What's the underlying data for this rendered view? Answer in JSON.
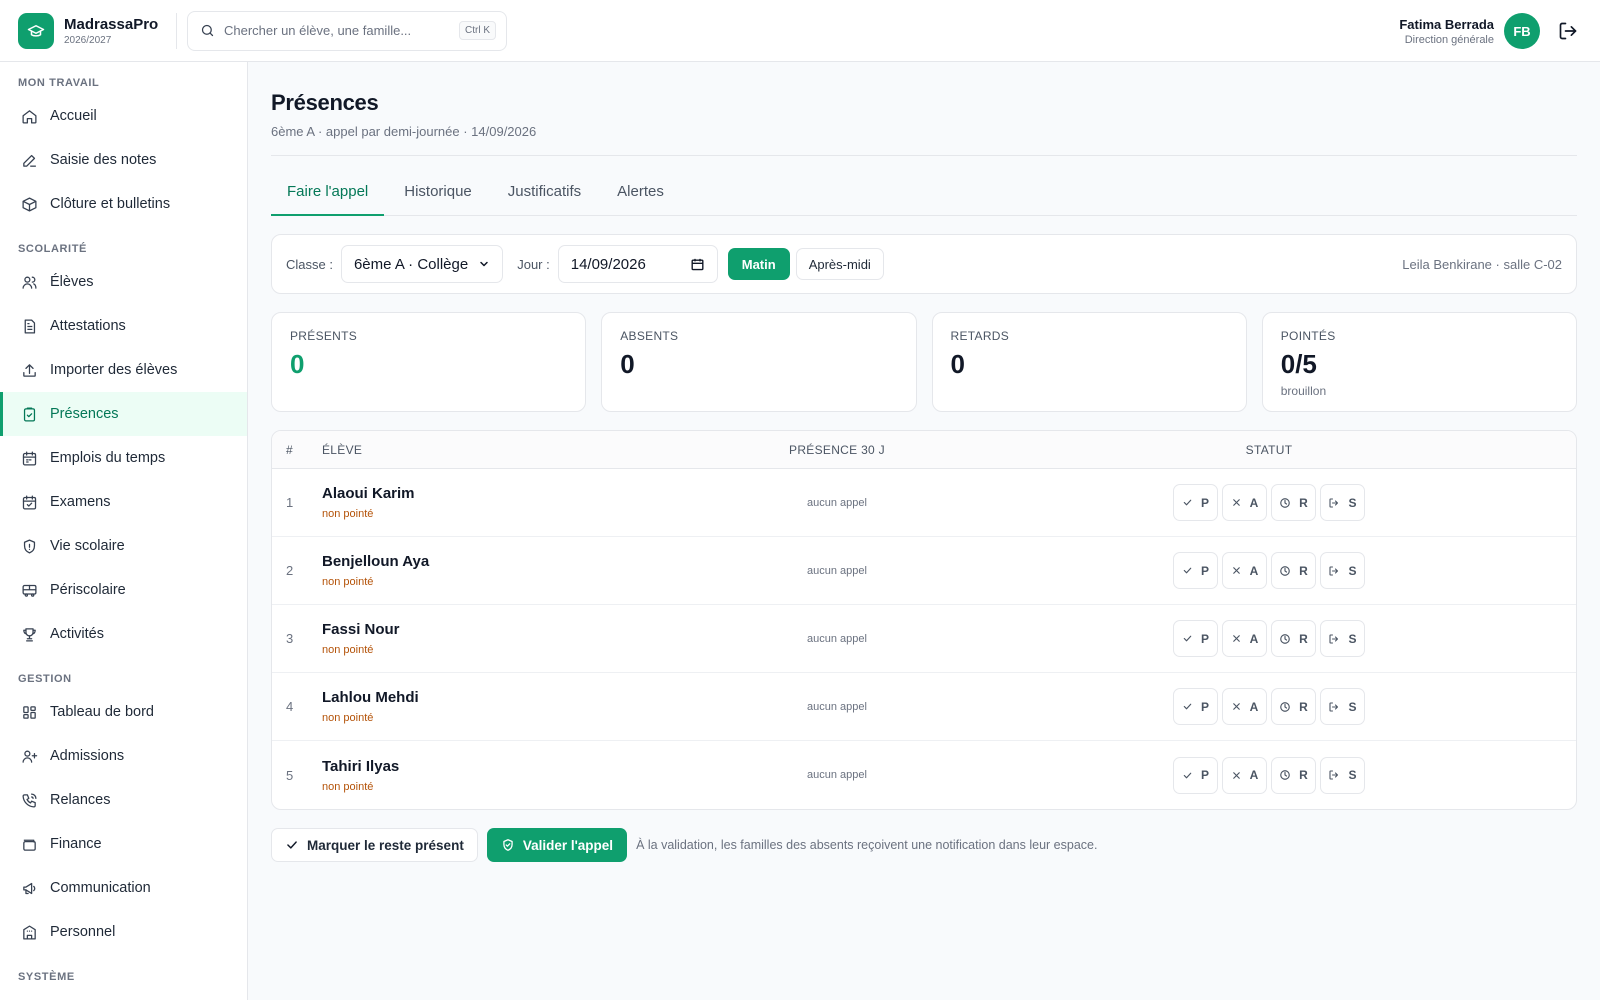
{
  "brand": {
    "name": "MadrassaPro",
    "year": "2026/2027"
  },
  "search": {
    "placeholder": "Chercher un élève, une famille...",
    "shortcut": "Ctrl K"
  },
  "user": {
    "name": "Fatima Berrada",
    "role": "Direction générale",
    "initials": "FB"
  },
  "sidebar": {
    "sections": [
      {
        "title": "MON TRAVAIL",
        "items": [
          {
            "label": "Accueil",
            "icon": "home-icon"
          },
          {
            "label": "Saisie des notes",
            "icon": "pencil-icon"
          },
          {
            "label": "Clôture et bulletins",
            "icon": "package-icon"
          }
        ]
      },
      {
        "title": "SCOLARITÉ",
        "items": [
          {
            "label": "Élèves",
            "icon": "users-icon"
          },
          {
            "label": "Attestations",
            "icon": "document-icon"
          },
          {
            "label": "Importer des élèves",
            "icon": "upload-icon"
          },
          {
            "label": "Présences",
            "icon": "clipboard-check-icon",
            "active": true
          },
          {
            "label": "Emplois du temps",
            "icon": "calendar-icon"
          },
          {
            "label": "Examens",
            "icon": "calendar-check-icon"
          },
          {
            "label": "Vie scolaire",
            "icon": "shield-icon"
          },
          {
            "label": "Périscolaire",
            "icon": "bus-icon"
          },
          {
            "label": "Activités",
            "icon": "trophy-icon"
          }
        ]
      },
      {
        "title": "GESTION",
        "items": [
          {
            "label": "Tableau de bord",
            "icon": "dashboard-icon"
          },
          {
            "label": "Admissions",
            "icon": "user-plus-icon"
          },
          {
            "label": "Relances",
            "icon": "phone-icon"
          },
          {
            "label": "Finance",
            "icon": "wallet-icon"
          },
          {
            "label": "Communication",
            "icon": "megaphone-icon"
          },
          {
            "label": "Personnel",
            "icon": "building-icon"
          }
        ]
      },
      {
        "title": "SYSTÈME",
        "items": []
      }
    ]
  },
  "page": {
    "title": "Présences",
    "subtitle": "6ème A · appel par demi-journée · 14/09/2026"
  },
  "tabs": [
    "Faire l'appel",
    "Historique",
    "Justificatifs",
    "Alertes"
  ],
  "filters": {
    "class_label": "Classe :",
    "class_value": "6ème A · Collège",
    "day_label": "Jour :",
    "day_value": "14/09/2026",
    "morning": "Matin",
    "afternoon": "Après-midi",
    "teacher_info": "Leila Benkirane · salle C-02"
  },
  "stats": [
    {
      "label": "PRÉSENTS",
      "value": "0",
      "color": "#0f9f6e"
    },
    {
      "label": "ABSENTS",
      "value": "0"
    },
    {
      "label": "RETARDS",
      "value": "0"
    },
    {
      "label": "POINTÉS",
      "value": "0/5",
      "note": "brouillon"
    }
  ],
  "table": {
    "headers": {
      "num": "#",
      "student": "ÉLÈVE",
      "presence": "PRÉSENCE 30 J",
      "status": "STATUT"
    },
    "status_buttons": [
      "P",
      "A",
      "R",
      "S"
    ],
    "rows": [
      {
        "num": "1",
        "name": "Alaoui Karim",
        "state": "non pointé",
        "presence": "aucun appel"
      },
      {
        "num": "2",
        "name": "Benjelloun Aya",
        "state": "non pointé",
        "presence": "aucun appel"
      },
      {
        "num": "3",
        "name": "Fassi Nour",
        "state": "non pointé",
        "presence": "aucun appel"
      },
      {
        "num": "4",
        "name": "Lahlou Mehdi",
        "state": "non pointé",
        "presence": "aucun appel"
      },
      {
        "num": "5",
        "name": "Tahiri Ilyas",
        "state": "non pointé",
        "presence": "aucun appel"
      }
    ]
  },
  "actions": {
    "mark_rest": "Marquer le reste présent",
    "validate": "Valider l'appel",
    "note": "À la validation, les familles des absents reçoivent une notification dans leur espace."
  }
}
